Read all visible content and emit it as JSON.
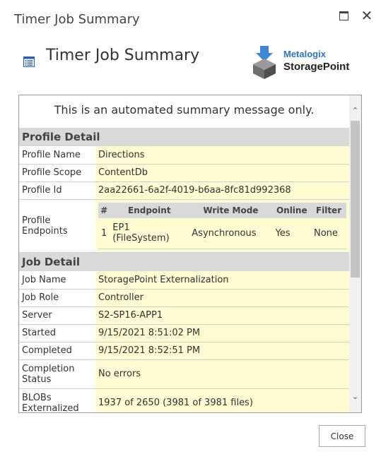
{
  "window": {
    "title": "Timer Job Summary",
    "maximize_icon": "maximize-icon",
    "close_icon": "✕"
  },
  "header": {
    "title": "Timer Job Summary",
    "icon": "list-view-icon",
    "logo": {
      "brand_top": "Metalogix",
      "brand_bottom": "StoragePoint",
      "accent": "#2e75b6"
    }
  },
  "report": {
    "intro": "This is an automated summary message only.",
    "profile_detail": {
      "heading": "Profile Detail",
      "rows": [
        {
          "label": "Profile Name",
          "value": "Directions"
        },
        {
          "label": "Profile Scope",
          "value": "ContentDb"
        },
        {
          "label": "Profile Id",
          "value": "2aa22661-6a2f-4019-b6aa-8fc81d992368"
        }
      ],
      "endpoints": {
        "label": "Profile Endpoints",
        "headers": [
          "#",
          "Endpoint",
          "Write Mode",
          "Online",
          "Filter"
        ],
        "rows": [
          [
            "1",
            "EP1 (FileSystem)",
            "Asynchronous",
            "Yes",
            "None"
          ]
        ]
      }
    },
    "job_detail": {
      "heading": "Job Detail",
      "rows": [
        {
          "label": "Job Name",
          "value": "StoragePoint Externalization"
        },
        {
          "label": "Job Role",
          "value": "Controller"
        },
        {
          "label": "Server",
          "value": "S2-SP16-APP1"
        },
        {
          "label": "Started",
          "value": "9/15/2021 8:51:02 PM"
        },
        {
          "label": "Completed",
          "value": "9/15/2021 8:52:51 PM"
        },
        {
          "label": "Completion Status",
          "value": "No errors"
        },
        {
          "label": "BLOBs Externalized",
          "value": "1937 of 2650 (3981 of 3981 files)"
        }
      ]
    },
    "colors": {
      "value_bg": "#fffbd2",
      "section_bg": "#d9d9d9"
    }
  },
  "footer": {
    "close_label": "Close"
  }
}
